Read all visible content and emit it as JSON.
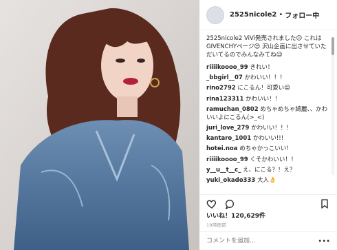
{
  "header": {
    "username": "2525nicole2",
    "separator": "•",
    "follow_status": "フォロー中"
  },
  "caption": {
    "username": "2525nicole2",
    "text": "ViVi発売されました☺︎ これはGIVENCHYページ😍 沢山企画に出させていただいてるのでみんなみてね😉"
  },
  "comments": [
    {
      "username": "riiiikoooo_99",
      "text": "きれい！"
    },
    {
      "username": "_bbgirl__07",
      "text": "かわいい！！！"
    },
    {
      "username": "rino2792",
      "text": "にこるん！可愛い😉"
    },
    {
      "username": "rina123311",
      "text": "かわいい！！"
    },
    {
      "username": "ramuchan_0802",
      "text": "めちゃめちゃ綺麗、、かわいいよにこるん(>_<)"
    },
    {
      "username": "juri_love_279",
      "text": "かわいい！！！"
    },
    {
      "username": "kantaro_1001",
      "text": "かわいい!!!"
    },
    {
      "username": "hotei.noa",
      "text": "めちゃかっこいい！"
    },
    {
      "username": "riiiikoooo_99",
      "text": "くそかわいい！！"
    },
    {
      "username": "y__u__t__c_",
      "text": "え、にこる？！え？"
    },
    {
      "username": "yuki_okado333",
      "text": "大人👌"
    }
  ],
  "stats": {
    "likes_label": "いいね！120,629件",
    "time_ago": "19時間前"
  },
  "add_comment": {
    "placeholder": "コメントを追加..."
  },
  "icons": {
    "like": "heart-outline-icon",
    "comment": "speech-bubble-icon",
    "save": "bookmark-icon",
    "more": "more-dots-icon"
  }
}
